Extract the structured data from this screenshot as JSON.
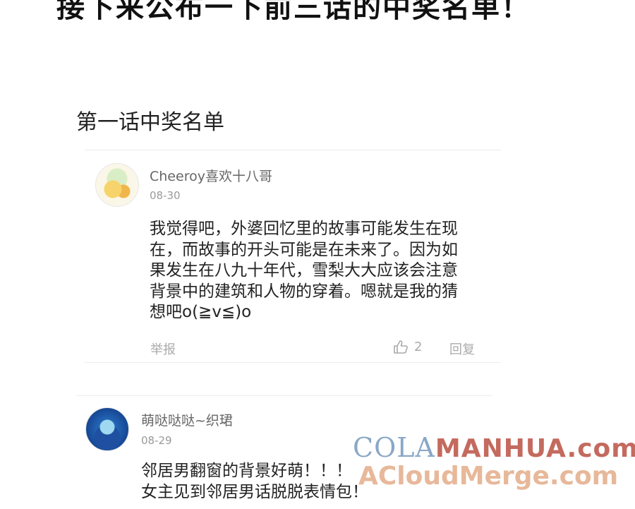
{
  "banner": {
    "text": "接下来公布一下前三话的中奖名单！"
  },
  "section": {
    "title": "第一话中奖名单"
  },
  "comments": [
    {
      "username": "Cheeroy喜欢十八哥",
      "date": "08-30",
      "lines": [
        "我觉得吧，外婆回忆里的故事可能发生在现",
        "在，而故事的开头可能是在未来了。因为如",
        "果发生在八九十年代，雪梨大大应该会注意",
        "背景中的建筑和人物的穿着。嗯就是我的猜",
        "想吧o(≧v≦)o"
      ],
      "report": "举报",
      "like_count": "2",
      "reply": "回复"
    },
    {
      "username": "萌哒哒哒~织珺",
      "date": "08-29",
      "lines": [
        "邻居男翻窗的背景好萌！！！",
        "女主见到邻居男话脱脱表情包！"
      ]
    }
  ],
  "watermark": {
    "line1_a": "COLA",
    "line1_b": "MANHUA",
    "line1_c": ".com",
    "line2": "ACloudMerge.com"
  }
}
